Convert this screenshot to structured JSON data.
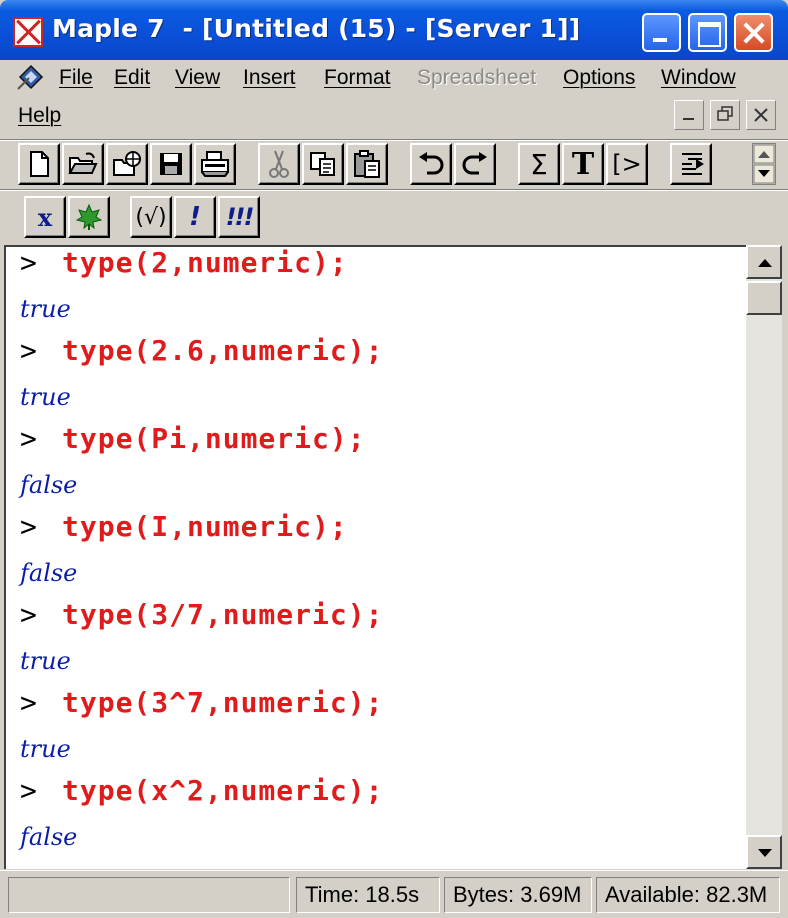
{
  "window": {
    "title": "Maple 7  - [Untitled (15) - [Server 1]]"
  },
  "menu": {
    "items": [
      {
        "label": "File",
        "enabled": true
      },
      {
        "label": "Edit",
        "enabled": true
      },
      {
        "label": "View",
        "enabled": true
      },
      {
        "label": "Insert",
        "enabled": true
      },
      {
        "label": "Format",
        "enabled": true
      },
      {
        "label": "Spreadsheet",
        "enabled": false
      },
      {
        "label": "Options",
        "enabled": true
      },
      {
        "label": "Window",
        "enabled": true
      },
      {
        "label": "Help",
        "enabled": true
      }
    ]
  },
  "toolbar": {
    "standard_icons": [
      "new-file-icon",
      "open-folder-icon",
      "open-url-icon",
      "save-icon",
      "print-icon",
      "cut-icon",
      "copy-icon",
      "paste-icon",
      "undo-icon",
      "redo-icon"
    ],
    "insert_math_label": "Σ",
    "insert_text_label": "T",
    "insert_input_label": "[>",
    "context": {
      "math_mode_label": "x",
      "check_label": "(√)",
      "exec_label": "!",
      "exec_all_label": "!!!"
    }
  },
  "worksheet": {
    "prompt_symbol": ">",
    "entries": [
      {
        "input": "type(2,numeric);",
        "output": "true"
      },
      {
        "input": "type(2.6,numeric);",
        "output": "true"
      },
      {
        "input": "type(Pi,numeric);",
        "output": "false"
      },
      {
        "input": "type(I,numeric);",
        "output": "false"
      },
      {
        "input": "type(3/7,numeric);",
        "output": "true"
      },
      {
        "input": "type(3^7,numeric);",
        "output": "true"
      },
      {
        "input": "type(x^2,numeric);",
        "output": "false"
      }
    ]
  },
  "status": {
    "time": "Time:  18.5s",
    "bytes": "Bytes: 3.69M",
    "available": "Available: 82.3M"
  },
  "colors": {
    "input": "#e01b1b",
    "output": "#0a1fa8",
    "titlebar": "#0a4fd8"
  }
}
